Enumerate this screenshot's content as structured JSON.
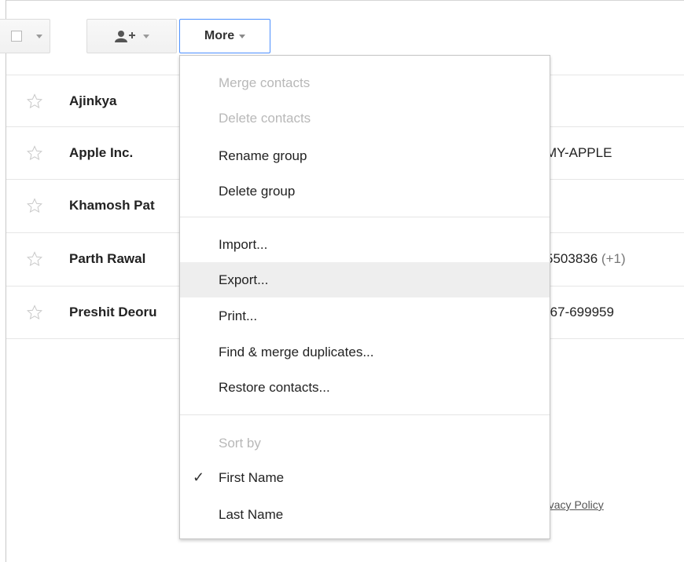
{
  "toolbar": {
    "more_label": "More"
  },
  "contacts": [
    {
      "name": "Ajinkya",
      "detail": "",
      "detail_extra": ""
    },
    {
      "name": "Apple Inc.",
      "detail": "MY-APPLE",
      "detail_extra": ""
    },
    {
      "name": "Khamosh Pat",
      "detail": "",
      "detail_extra": ""
    },
    {
      "name": "Parth Rawal",
      "detail": "5503836",
      "detail_extra": "(+1)"
    },
    {
      "name": "Preshit Deoru",
      "detail": "-67-699959",
      "detail_extra": ""
    }
  ],
  "footer": {
    "privacy": "rivacy Policy"
  },
  "menu": {
    "merge": "Merge contacts",
    "delete_contacts": "Delete contacts",
    "rename_group": "Rename group",
    "delete_group": "Delete group",
    "import": "Import...",
    "export": "Export...",
    "print": "Print...",
    "find_merge": "Find & merge duplicates...",
    "restore": "Restore contacts...",
    "sort_by": "Sort by",
    "first_name": "First Name",
    "last_name": "Last Name",
    "checked": "First Name"
  },
  "colors": {
    "accent_border": "#4d90fe",
    "hover_bg": "#eeeeee",
    "disabled_text": "#b8b8b8"
  }
}
